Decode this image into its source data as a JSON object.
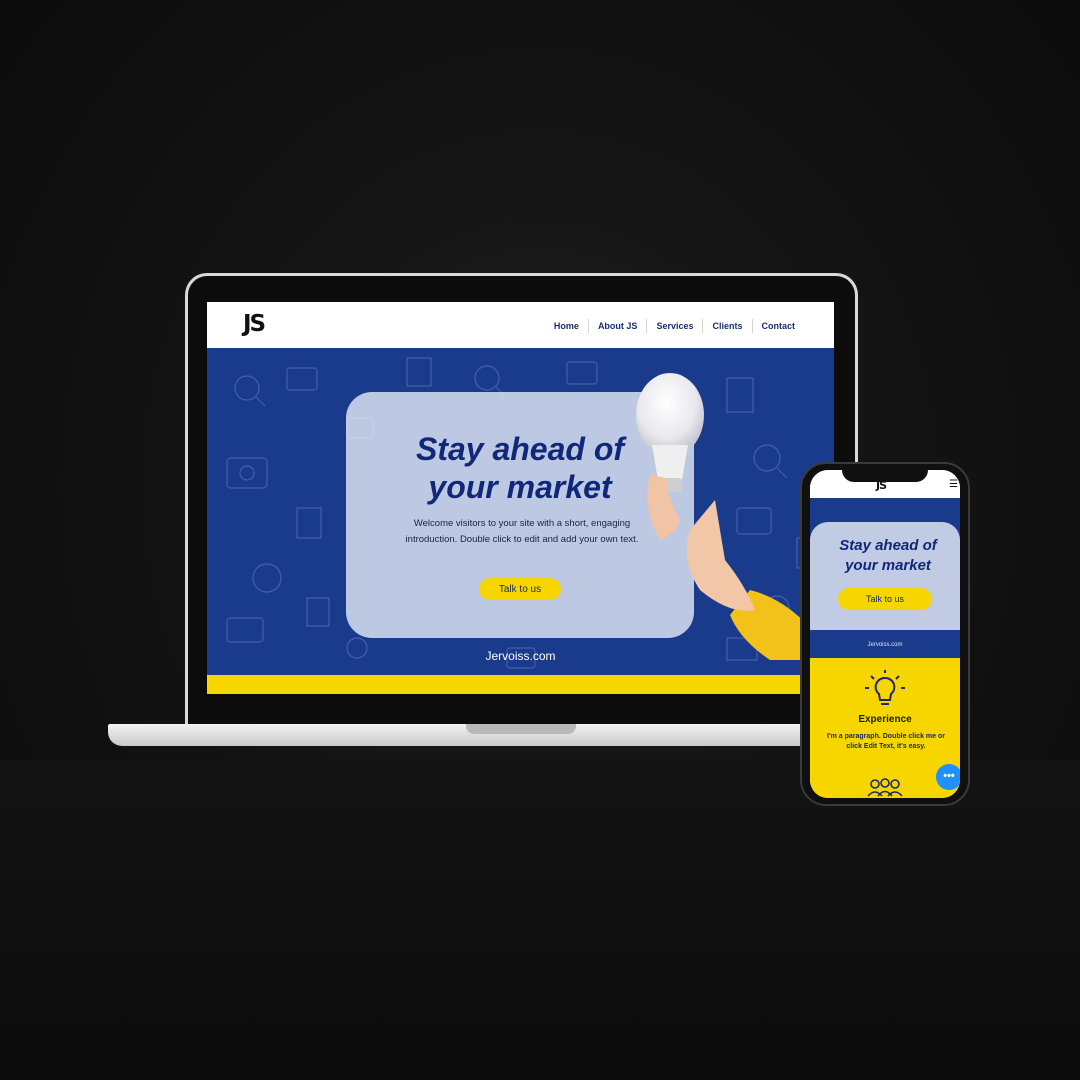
{
  "desktop": {
    "logo": "JS",
    "nav": [
      "Home",
      "About JS",
      "Services",
      "Clients",
      "Contact"
    ],
    "hero": {
      "title_line1": "Stay ahead of",
      "title_line2": "your market",
      "text": "Welcome visitors to your site with a short, engaging introduction. Double click to edit and add your own text.",
      "cta": "Talk to us",
      "footer_text": "Jervoiss.com"
    }
  },
  "mobile": {
    "logo": "JS",
    "menu_icon": "☰",
    "hero": {
      "title_line1": "Stay ahead of",
      "title_line2": "your market",
      "cta": "Talk to us",
      "url": "Jervoiss.com"
    },
    "feature": {
      "heading": "Experience",
      "text": "I'm a paragraph. Double click me or click Edit Text, it's easy."
    },
    "chat_label": "•••"
  },
  "colors": {
    "navy": "#1a3a8c",
    "title_navy": "#10287a",
    "yellow": "#f7d600",
    "chat_blue": "#1e90ff"
  }
}
